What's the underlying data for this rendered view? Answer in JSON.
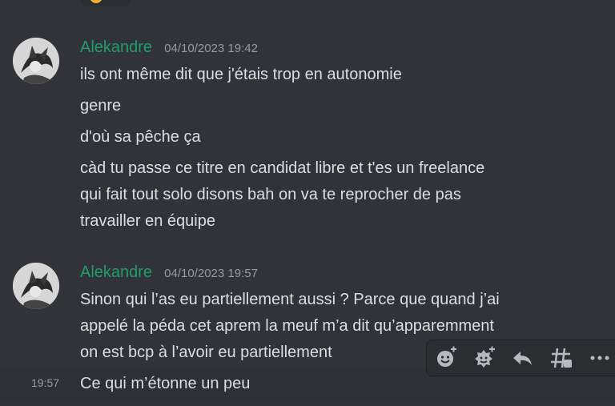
{
  "messages": [
    {
      "author": "Alekandre",
      "timestamp": "04/10/2023 19:42",
      "lines": [
        "ils ont même dit que j'étais trop en autonomie",
        "genre",
        "d'où sa pêche ça",
        "càd tu passe ce titre en candidat libre et t'es un freelance",
        "qui fait tout solo disons bah on va te reprocher de pas",
        "travailler en équipe"
      ]
    },
    {
      "author": "Alekandre",
      "timestamp": "04/10/2023 19:57",
      "lines": [
        "Sinon qui l’as eu partiellement aussi ? Parce que quand j’ai",
        "appelé la péda cet aprem la meuf m’a dit qu’apparemment",
        "on est bcp à l’avoir eu partiellement"
      ]
    }
  ],
  "hovered": {
    "time": "19:57",
    "text": "Ce qui m’étonne un peu"
  },
  "toolbar": {
    "icons": [
      "add-reaction-icon",
      "super-reaction-icon",
      "reply-icon",
      "create-thread-icon",
      "more-options-icon"
    ]
  },
  "colors": {
    "background": "#313338",
    "username": "#1f9d6b",
    "text": "#dbdee1",
    "muted": "#949ba4",
    "toolbar": "#2b2d31"
  }
}
